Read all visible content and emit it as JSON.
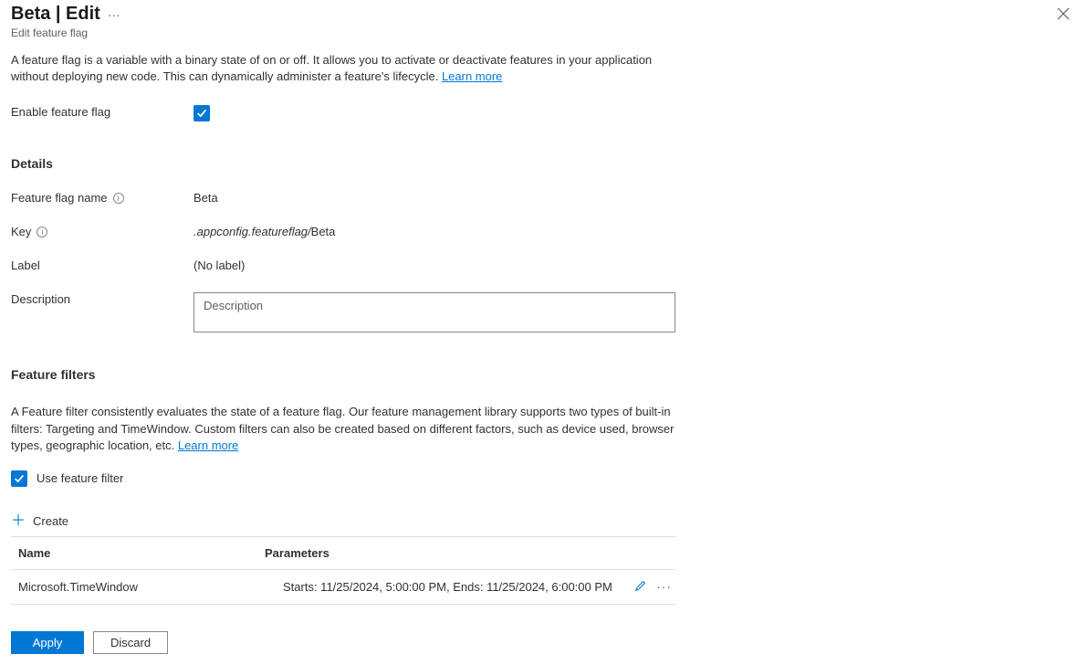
{
  "header": {
    "title": "Beta | Edit",
    "subtitle": "Edit feature flag"
  },
  "intro": {
    "text": "A feature flag is a variable with a binary state of on or off. It allows you to activate or deactivate features in your application without deploying new code. This can dynamically administer a feature's lifecycle. ",
    "learn_more": "Learn more"
  },
  "enable": {
    "label": "Enable feature flag",
    "checked": true
  },
  "details": {
    "heading": "Details",
    "name_label": "Feature flag name",
    "name_value": "Beta",
    "key_label": "Key",
    "key_prefix": ".appconfig.featureflag/",
    "key_value": "Beta",
    "label_label": "Label",
    "label_value": "(No label)",
    "description_label": "Description",
    "description_placeholder": "Description",
    "description_value": ""
  },
  "filters": {
    "heading": "Feature filters",
    "intro_text": "A Feature filter consistently evaluates the state of a feature flag. Our feature management library supports two types of built-in filters: Targeting and TimeWindow. Custom filters can also be created based on different factors, such as device used, browser types, geographic location, etc. ",
    "learn_more": "Learn more",
    "use_filter_label": "Use feature filter",
    "use_filter_checked": true,
    "create_label": "Create",
    "columns": {
      "name": "Name",
      "params": "Parameters"
    },
    "rows": [
      {
        "name": "Microsoft.TimeWindow",
        "params": "Starts: 11/25/2024, 5:00:00 PM, Ends: 11/25/2024, 6:00:00 PM"
      }
    ]
  },
  "footer": {
    "apply": "Apply",
    "discard": "Discard"
  }
}
